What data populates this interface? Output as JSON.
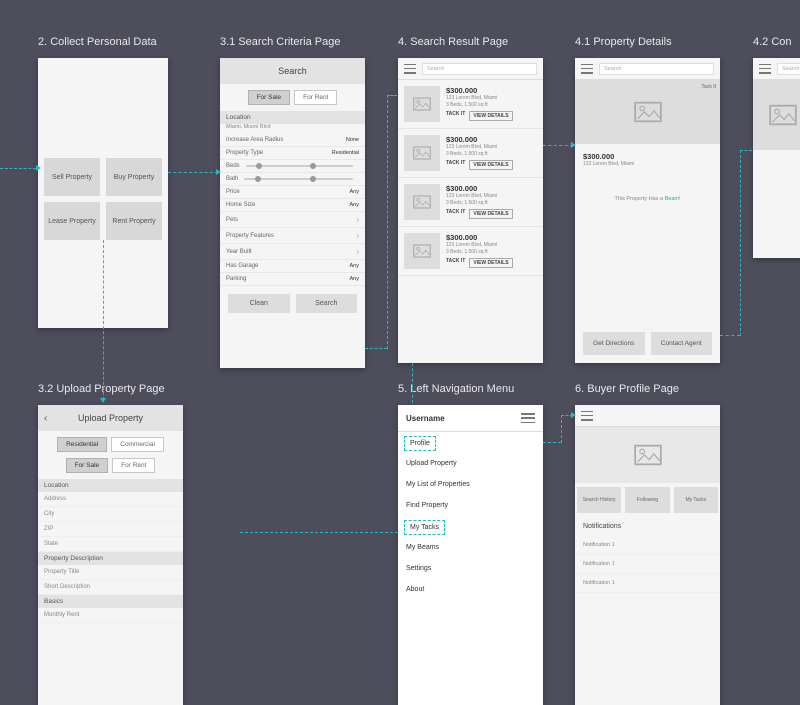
{
  "titles": {
    "s2": "2. Collect Personal Data",
    "s31": "3.1 Search Criteria Page",
    "s4": "4. Search Result Page",
    "s41": "4.1 Property Details",
    "s42": "4.2 Con",
    "s32": "3.2 Upload Property Page",
    "s5": "5. Left Navigation Menu",
    "s6": "6. Buyer Profile Page"
  },
  "s2": {
    "buttons": [
      "Sell Property",
      "Buy Property",
      "Lease Property",
      "Rent Property"
    ]
  },
  "s31": {
    "header": "Search",
    "tabs": {
      "a": "For Sale",
      "b": "For Rent"
    },
    "location_label": "Location",
    "location_value": "Miami, Miami Blvd",
    "rows": {
      "radius": {
        "label": "Increase Area Radius",
        "value": "None"
      },
      "ptype": {
        "label": "Property Type",
        "value": "Residential"
      },
      "beds": {
        "label": "Beds"
      },
      "bath": {
        "label": "Bath"
      },
      "price": {
        "label": "Price",
        "value": "Any"
      },
      "size": {
        "label": "Home Size",
        "value": "Any"
      },
      "pets": {
        "label": "Pets"
      },
      "feat": {
        "label": "Property Features"
      },
      "year": {
        "label": "Year Built"
      },
      "garage": {
        "label": "Has Garage",
        "value": "Any"
      },
      "park": {
        "label": "Parking",
        "value": "Any"
      }
    },
    "clean": "Clean",
    "search": "Search"
  },
  "s4": {
    "search_placeholder": "Search",
    "results": [
      {
        "price": "$300.000",
        "addr": "123 Lorem Blvd, Miami",
        "meta": "3 Beds, 1.500 sq ft",
        "tack": "TACK IT",
        "view": "VIEW DETAILS"
      },
      {
        "price": "$300.000",
        "addr": "123 Lorem Blvd, Miami",
        "meta": "3 Beds, 1.500 sq ft",
        "tack": "TACK IT",
        "view": "VIEW DETAILS"
      },
      {
        "price": "$300.000",
        "addr": "123 Lorem Blvd, Miami",
        "meta": "3 Beds, 1.500 sq ft",
        "tack": "TACK IT",
        "view": "VIEW DETAILS"
      },
      {
        "price": "$300.000",
        "addr": "123 Lorem Blvd, Miami",
        "meta": "3 Beds, 1.500 sq ft",
        "tack": "TACK IT",
        "view": "VIEW DETAILS"
      }
    ]
  },
  "s41": {
    "search_placeholder": "Search",
    "tackit": "Tack It",
    "price": "$300.000",
    "addr": "123 Lorem Blvd, Miami",
    "note_a": "This Property Has a ",
    "note_b": "Beam!",
    "btn_a": "Get Directions",
    "btn_b": "Contact Agent"
  },
  "s32": {
    "header": "Upload Property",
    "tabs1": {
      "a": "Residential",
      "b": "Commercial"
    },
    "tabs2": {
      "a": "For Sale",
      "b": "For Rent"
    },
    "sec_loc": "Location",
    "fields_loc": [
      "Address",
      "City",
      "ZIP",
      "State"
    ],
    "sec_desc": "Property Description",
    "fields_desc": [
      "Property Title",
      "Short Description"
    ],
    "sec_basics": "Basics",
    "fields_basics": [
      "Monthly Rent"
    ]
  },
  "s5": {
    "username": "Username",
    "items": [
      "Profile",
      "Upload Property",
      "My List of Properties",
      "Find Property",
      "My Tacks",
      "My Beams",
      "Settings",
      "About"
    ]
  },
  "s6": {
    "tabs": [
      "Search History",
      "Following",
      "My Tacks"
    ],
    "notif_header": "Notifications",
    "notifs": [
      "Notification 1",
      "Notification 1",
      "Notification 1"
    ]
  }
}
